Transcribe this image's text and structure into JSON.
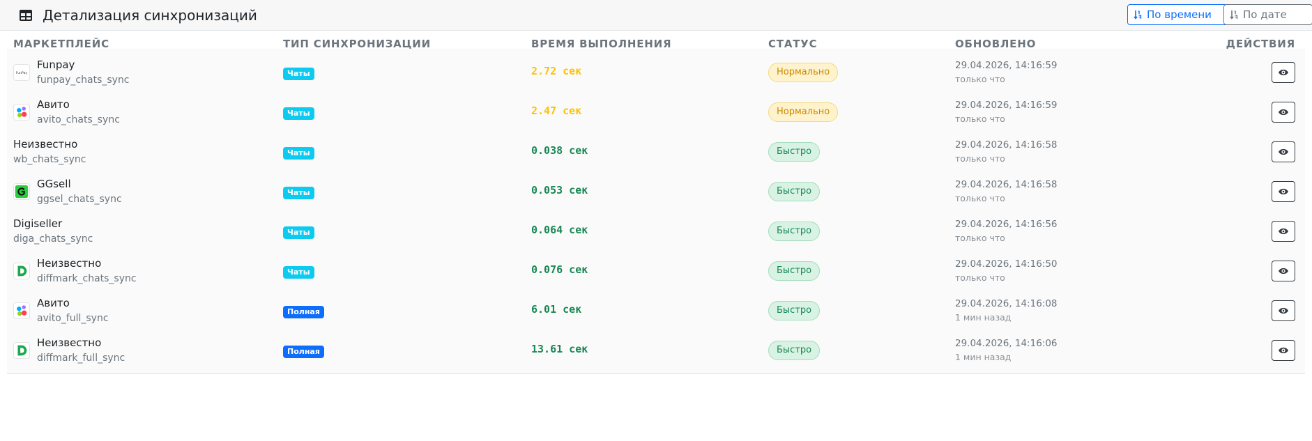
{
  "header": {
    "title": "Детализация синхронизаций",
    "sort_time_label": "По времени",
    "sort_date_label": "По дате"
  },
  "columns": {
    "marketplace": "МАРКЕТПЛЕЙС",
    "sync_type": "ТИП СИНХРОНИЗАЦИИ",
    "duration": "ВРЕМЯ ВЫПОЛНЕНИЯ",
    "status": "СТАТУС",
    "updated": "ОБНОВЛЕНО",
    "actions": "ДЕЙСТВИЯ"
  },
  "colors": {
    "primary": "#0d6efd",
    "info": "#0dcaf0",
    "warning_text": "#ffc107",
    "success_text": "#198754"
  },
  "rows": [
    {
      "name": "Funpay",
      "code": "funpay_chats_sync",
      "logo": "funpay-logo",
      "type": "Чаты",
      "type_kind": "chats",
      "duration": "2.72 сек",
      "duration_kind": "warn",
      "status": "Нормально",
      "status_kind": "warn",
      "date": "29.04.2026, 14:16:59",
      "ago": "только что"
    },
    {
      "name": "Авито",
      "code": "avito_chats_sync",
      "logo": "avito-logo",
      "type": "Чаты",
      "type_kind": "chats",
      "duration": "2.47 сек",
      "duration_kind": "warn",
      "status": "Нормально",
      "status_kind": "warn",
      "date": "29.04.2026, 14:16:59",
      "ago": "только что"
    },
    {
      "name": "Неизвестно",
      "code": "wb_chats_sync",
      "logo": "",
      "type": "Чаты",
      "type_kind": "chats",
      "duration": "0.038 сек",
      "duration_kind": "ok",
      "status": "Быстро",
      "status_kind": "ok",
      "date": "29.04.2026, 14:16:58",
      "ago": "только что"
    },
    {
      "name": "GGsell",
      "code": "ggsel_chats_sync",
      "logo": "ggsel-logo",
      "type": "Чаты",
      "type_kind": "chats",
      "duration": "0.053 сек",
      "duration_kind": "ok",
      "status": "Быстро",
      "status_kind": "ok",
      "date": "29.04.2026, 14:16:58",
      "ago": "только что"
    },
    {
      "name": "Digiseller",
      "code": "diga_chats_sync",
      "logo": "",
      "type": "Чаты",
      "type_kind": "chats",
      "duration": "0.064 сек",
      "duration_kind": "ok",
      "status": "Быстро",
      "status_kind": "ok",
      "date": "29.04.2026, 14:16:56",
      "ago": "только что"
    },
    {
      "name": "Неизвестно",
      "code": "diffmark_chats_sync",
      "logo": "diffmark-logo",
      "type": "Чаты",
      "type_kind": "chats",
      "duration": "0.076 сек",
      "duration_kind": "ok",
      "status": "Быстро",
      "status_kind": "ok",
      "date": "29.04.2026, 14:16:50",
      "ago": "только что"
    },
    {
      "name": "Авито",
      "code": "avito_full_sync",
      "logo": "avito-logo",
      "type": "Полная",
      "type_kind": "full",
      "duration": "6.01 сек",
      "duration_kind": "ok",
      "status": "Быстро",
      "status_kind": "ok",
      "date": "29.04.2026, 14:16:08",
      "ago": "1 мин назад"
    },
    {
      "name": "Неизвестно",
      "code": "diffmark_full_sync",
      "logo": "diffmark-logo",
      "type": "Полная",
      "type_kind": "full",
      "duration": "13.61 сек",
      "duration_kind": "ok",
      "status": "Быстро",
      "status_kind": "ok",
      "date": "29.04.2026, 14:16:06",
      "ago": "1 мин назад"
    }
  ]
}
